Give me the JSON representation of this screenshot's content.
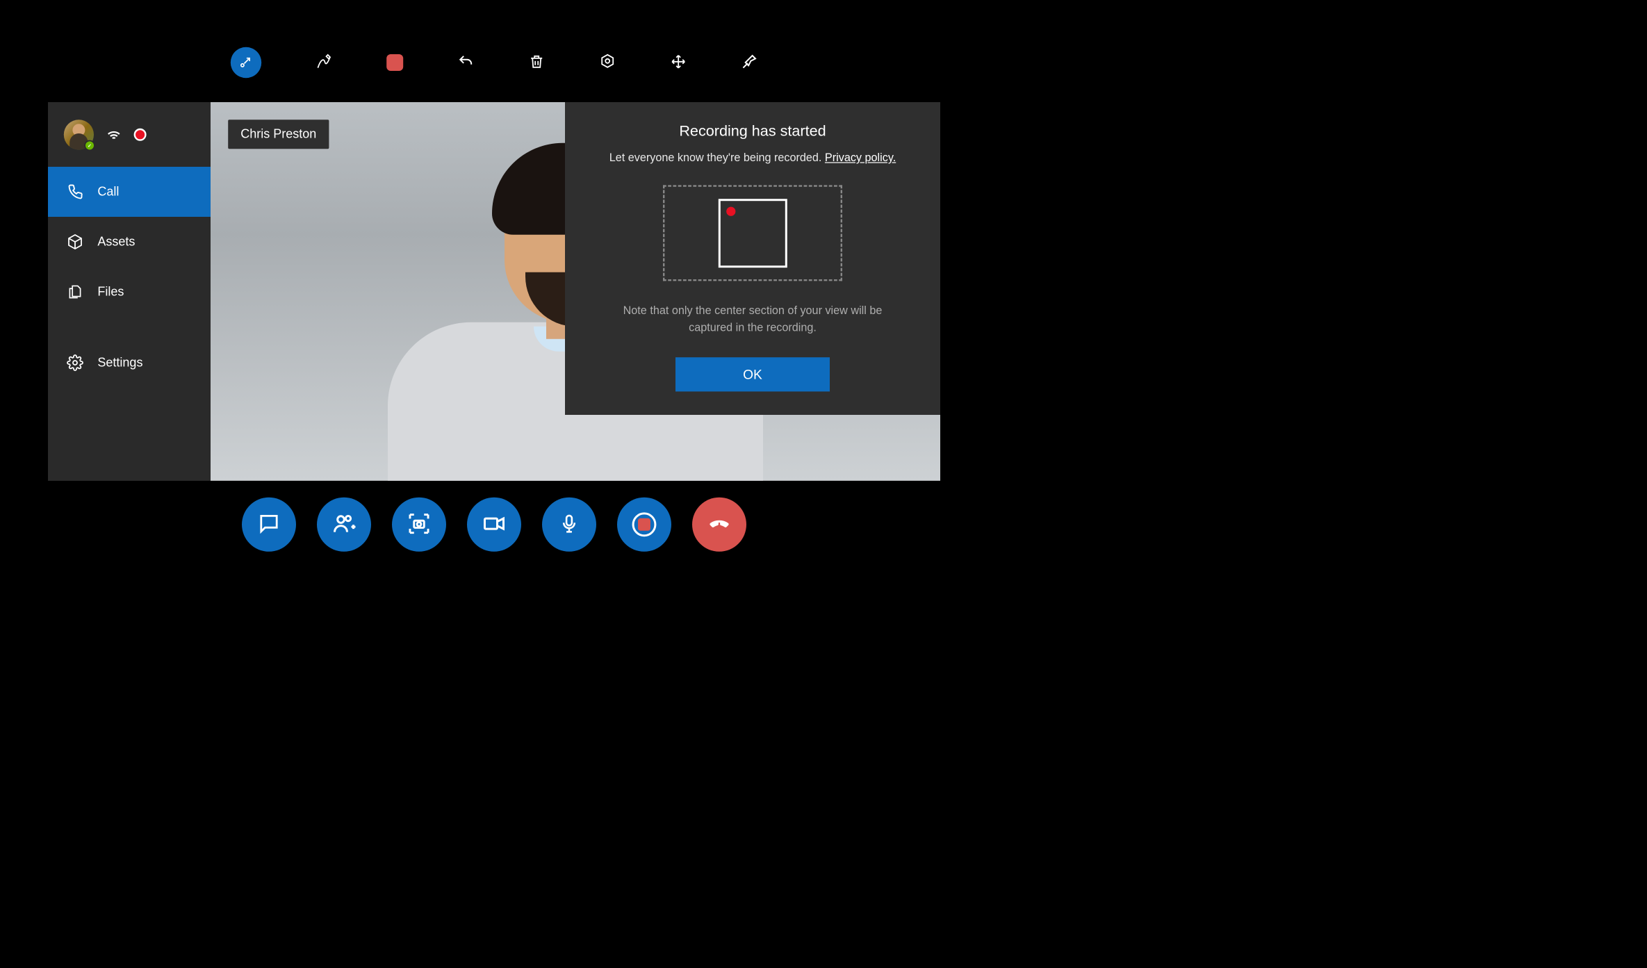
{
  "toolbar": {
    "icons": [
      "minimize-icon",
      "pen-icon",
      "stop-record-icon",
      "undo-icon",
      "trash-icon",
      "focus-icon",
      "move-icon",
      "pin-icon"
    ]
  },
  "sidebar": {
    "items": [
      {
        "label": "Call",
        "icon": "phone-icon",
        "active": true
      },
      {
        "label": "Assets",
        "icon": "box-icon",
        "active": false
      },
      {
        "label": "Files",
        "icon": "files-icon",
        "active": false
      }
    ],
    "settings_label": "Settings"
  },
  "video": {
    "participant_name": "Chris Preston"
  },
  "modal": {
    "title": "Recording has started",
    "subtext_prefix": "Let everyone know they're being recorded. ",
    "privacy_link": "Privacy policy.",
    "note": "Note that only the center section of your view will be captured in the recording.",
    "ok_label": "OK"
  },
  "call_controls": {
    "icons": [
      "chat-icon",
      "add-people-icon",
      "camera-capture-icon",
      "video-icon",
      "mic-icon",
      "record-icon",
      "hangup-icon"
    ]
  },
  "colors": {
    "accent": "#0e6cbe",
    "danger": "#d9534f",
    "record": "#e81123"
  }
}
